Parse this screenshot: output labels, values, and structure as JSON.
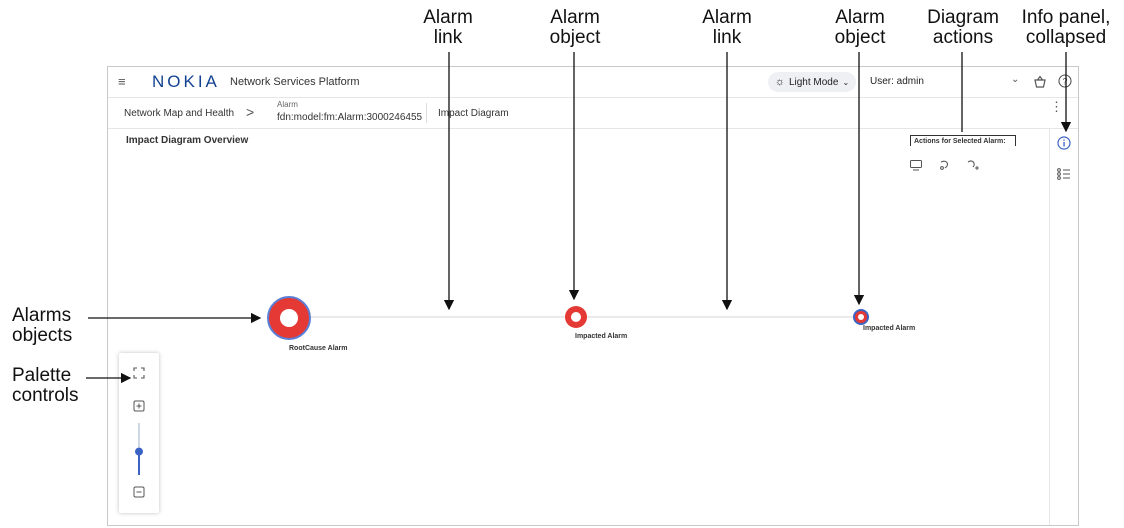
{
  "annotations": {
    "alarm_link_1": [
      "Alarm",
      "link"
    ],
    "alarm_object_1": [
      "Alarm",
      "object"
    ],
    "alarm_link_2": [
      "Alarm",
      "link"
    ],
    "alarm_object_2": [
      "Alarm",
      "object"
    ],
    "diagram_actions": [
      "Diagram",
      "actions"
    ],
    "info_panel": [
      "Info panel,",
      "collapsed"
    ],
    "alarms_objects": [
      "Alarms",
      "objects"
    ],
    "palette_controls": [
      "Palette",
      "controls"
    ]
  },
  "app": {
    "menu_icon": "hamburger-icon",
    "logo": "NOKIA",
    "title": "Network Services Platform",
    "theme_button": "Light Mode",
    "user": "User: admin",
    "colors": {
      "logo": "#124191",
      "alarm_red": "#e53935",
      "alarm_ring": "#5b7fd6",
      "accent": "#3b63c4"
    }
  },
  "breadcrumb": {
    "item1": "Network Map and Health",
    "separator": ">",
    "item2_label": "Alarm",
    "item2_value": "fdn:model:fm:Alarm:3000246455",
    "item3": "Impact Diagram"
  },
  "diagram": {
    "title": "Impact Diagram Overview",
    "actions_title": "Actions for Selected Alarm:",
    "nodes": [
      {
        "label": "RootCause Alarm"
      },
      {
        "label": "Impacted Alarm"
      },
      {
        "label": "Impacted Alarm"
      }
    ]
  },
  "palette": {
    "zoom_level": 0.45
  }
}
